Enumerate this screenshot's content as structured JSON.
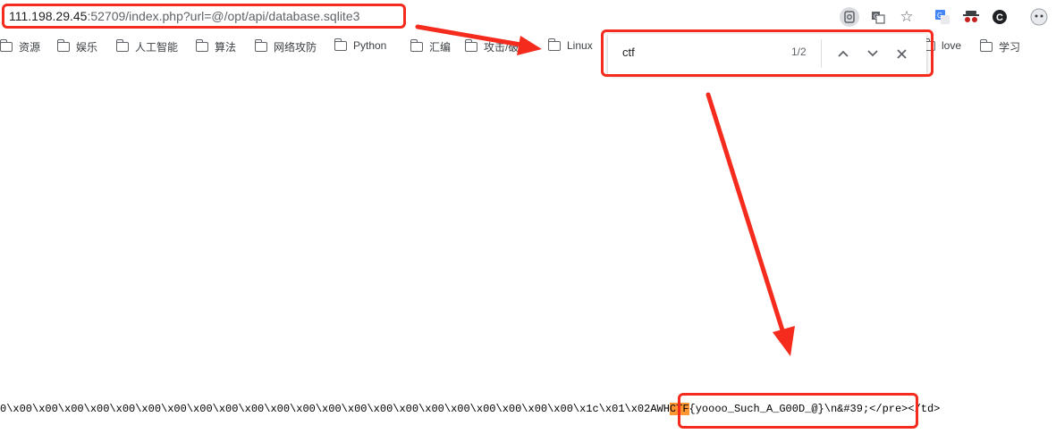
{
  "address_bar": {
    "host": "111.198.29.45",
    "rest": ":52709/index.php?url=@/opt/api/database.sqlite3"
  },
  "toolbar_icons": [
    "zoom-icon",
    "translate-icon",
    "star-icon",
    "google-translate-icon",
    "incognito-icon",
    "extension-icon",
    "profile-icon"
  ],
  "bookmarks": [
    {
      "label": "资源"
    },
    {
      "label": "娱乐"
    },
    {
      "label": "人工智能"
    },
    {
      "label": "算法"
    },
    {
      "label": "网络攻防"
    },
    {
      "label": "Python"
    },
    {
      "label": "汇编"
    },
    {
      "label": "攻击/破"
    },
    {
      "label": "Linux"
    },
    {
      "label": "love"
    },
    {
      "label": "学习"
    }
  ],
  "find_bar": {
    "query": "ctf",
    "count": "1/2"
  },
  "page_content": {
    "before": "0\\x00\\x00\\x00\\x00\\x00\\x00\\x00\\x00\\x00\\x00\\x00\\x00\\x00\\x00\\x00\\x00\\x00\\x00\\x00\\x00\\x00\\x00\\x1c\\x01\\x02AWH",
    "highlight": "CTF",
    "after": "{yoooo_Such_A_G00D_@}\\n&#39;</pre></td>"
  },
  "colors": {
    "annotation_red": "#f52b1e",
    "find_highlight": "#ff9632"
  }
}
